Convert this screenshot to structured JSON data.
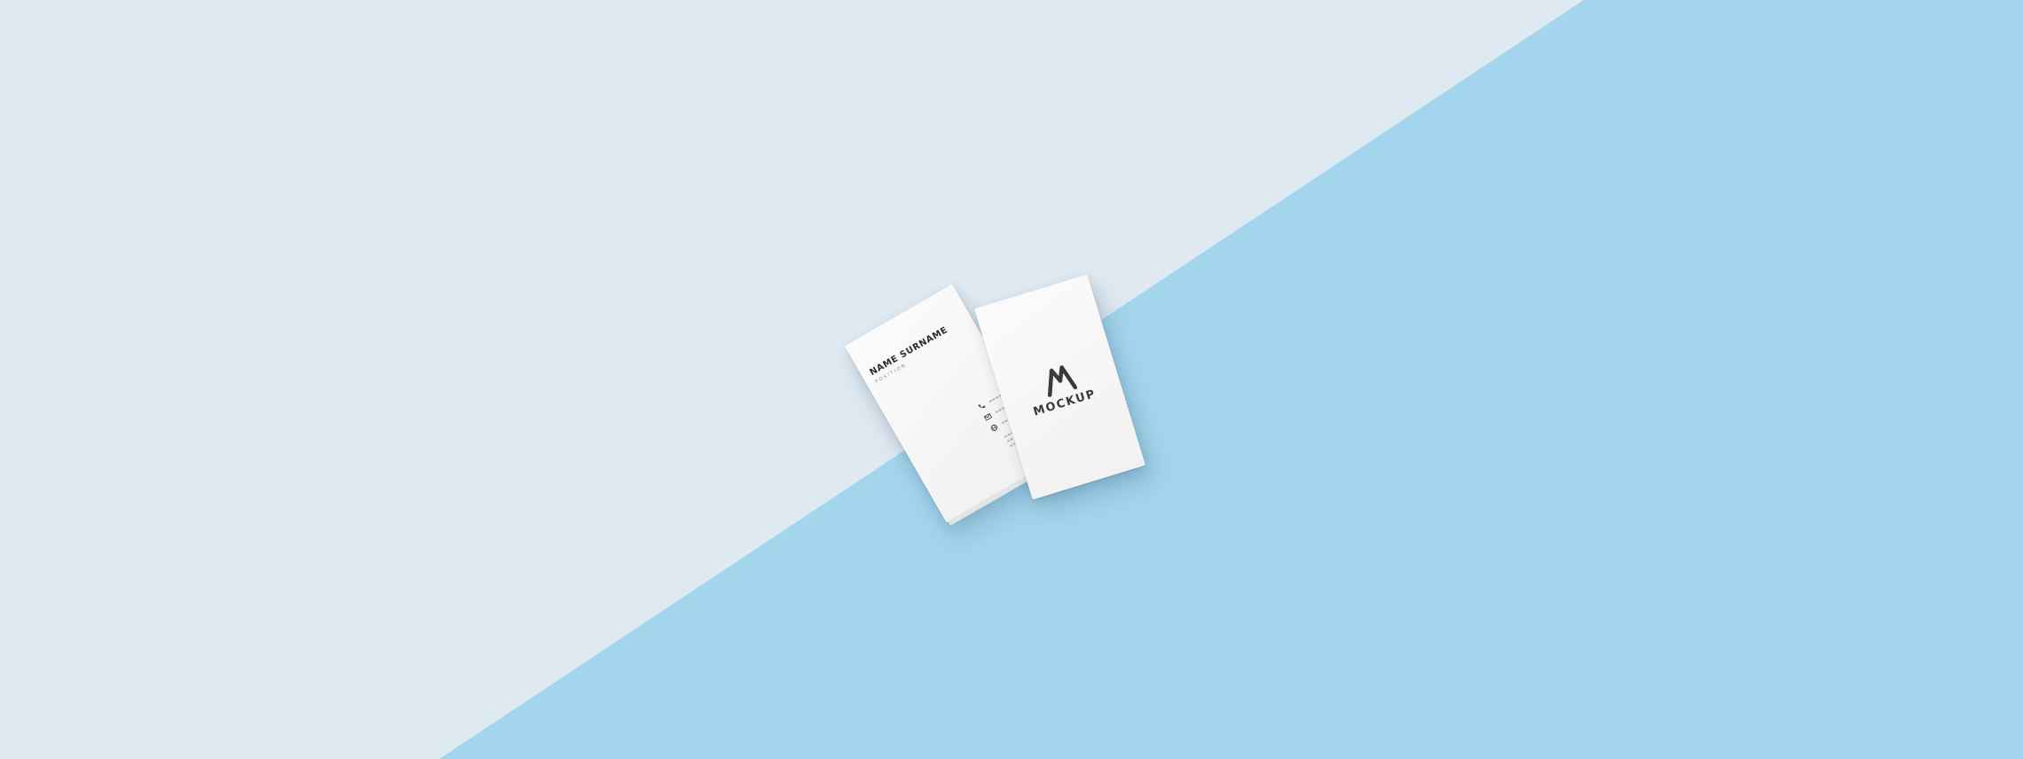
{
  "scene": {
    "colors": {
      "background_light": "#dfe9f1",
      "background_blue": "#a3d5ec",
      "card": "#f6f6f6",
      "ink": "#3a3a3a"
    }
  },
  "back_card": {
    "name": "NAME SURNAME",
    "position": "POSITION",
    "icons": [
      "phone-icon",
      "mail-icon",
      "globe-icon"
    ]
  },
  "front_card": {
    "logo_icon": "mountain-m-logo",
    "logo_text": "MOCKUP"
  }
}
